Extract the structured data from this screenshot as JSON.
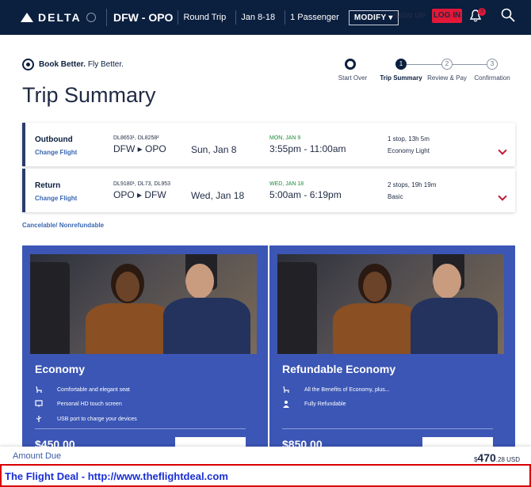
{
  "nav": {
    "brand": "DELTA",
    "route": "DFW - OPO",
    "trip_type": "Round Trip",
    "dates": "Jan 8-18",
    "passengers": "1 Passenger",
    "modify": "MODIFY",
    "sign_up": "SIGN UP",
    "log_in": "LOG IN",
    "notifications": "3"
  },
  "tagline": {
    "brand": "Book Better.",
    "sub": "Fly Better."
  },
  "page_title": "Trip Summary",
  "stepper": [
    {
      "num": "",
      "label": "Start Over"
    },
    {
      "num": "1",
      "label": "Trip Summary"
    },
    {
      "num": "2",
      "label": "Review & Pay"
    },
    {
      "num": "3",
      "label": "Confirmation"
    }
  ],
  "flights": [
    {
      "name": "Outbound",
      "change": "Change Flight",
      "numbers": "DL8653¹, DL8258²",
      "route": "DFW ▸ OPO",
      "date": "Sun, Jan 8",
      "arrival_day": "MON, JAN 9",
      "times": "3:55pm - 11:00am",
      "stops": "1 stop, 13h 5m",
      "fare": "Economy Light"
    },
    {
      "name": "Return",
      "change": "Change Flight",
      "numbers": "DL9180¹, DL73, DL953",
      "route": "OPO ▸ DFW",
      "date": "Wed, Jan 18",
      "arrival_day": "WED, JAN 18",
      "times": "5:00am - 6:19pm",
      "stops": "2 stops,  19h 19m",
      "fare": "Basic"
    }
  ],
  "policy": "Cancelable/ Nonrefundable",
  "cards": [
    {
      "title": "Economy",
      "features": [
        {
          "icon": "seat-icon",
          "text": "Comfortable and elegant seat"
        },
        {
          "icon": "screen-icon",
          "text": "Personal HD touch screen"
        },
        {
          "icon": "usb-icon",
          "text": "USB port to charge your devices"
        }
      ],
      "price_peek": "$450.00"
    },
    {
      "title": "Refundable Economy",
      "features": [
        {
          "icon": "seat-icon",
          "text": "All the Benefits of Economy, plus..."
        },
        {
          "icon": "person-icon",
          "text": "Fully Refundable"
        }
      ],
      "price_peek": "$850.00"
    }
  ],
  "amount": {
    "label": "Amount Due",
    "currency_symbol": "$",
    "dollars": "470",
    "cents": ".28 USD"
  },
  "footer": "The Flight Deal - http://www.theflightdeal.com",
  "colors": {
    "navy": "#0b1f3f",
    "brand_red": "#e31837",
    "card_blue": "#3b56b5",
    "link_blue": "#3a67b1"
  }
}
